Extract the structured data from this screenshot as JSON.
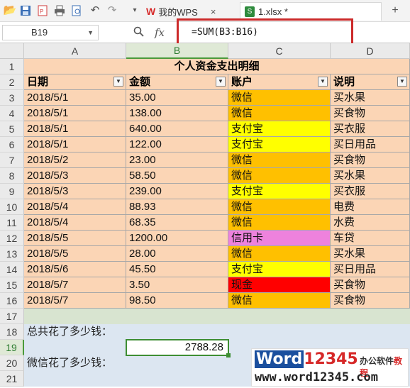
{
  "toolbar": {
    "icons": [
      "open-folder-icon",
      "save-icon",
      "export-pdf-icon",
      "print-icon",
      "print-preview-icon",
      "undo-icon",
      "redo-icon",
      "more-icon"
    ],
    "tabs": [
      {
        "label": "我的WPS",
        "close": "×"
      },
      {
        "label": "1.xlsx *",
        "close": "×"
      }
    ],
    "add_tab": "+"
  },
  "formula_bar": {
    "name_box": "B19",
    "fx": "fx",
    "formula": "=SUM(B3:B16)"
  },
  "columns": [
    "A",
    "B",
    "C",
    "D"
  ],
  "rows": [
    "1",
    "2",
    "3",
    "4",
    "5",
    "6",
    "7",
    "8",
    "9",
    "10",
    "11",
    "12",
    "13",
    "14",
    "15",
    "16",
    "17",
    "18",
    "19",
    "20",
    "21"
  ],
  "sheet": {
    "title": "个人资金支出明细",
    "headers": [
      "日期",
      "金额",
      "账户",
      "说明"
    ],
    "data": [
      {
        "date": "2018/5/1",
        "amount": "35.00",
        "account": "微信",
        "note": "买水果",
        "account_color": "#ffc000"
      },
      {
        "date": "2018/5/1",
        "amount": "138.00",
        "account": "微信",
        "note": "买食物",
        "account_color": "#ffc000"
      },
      {
        "date": "2018/5/1",
        "amount": "640.00",
        "account": "支付宝",
        "note": "买衣服",
        "account_color": "#ffff00"
      },
      {
        "date": "2018/5/1",
        "amount": "122.00",
        "account": "支付宝",
        "note": "买日用品",
        "account_color": "#ffff00"
      },
      {
        "date": "2018/5/2",
        "amount": "23.00",
        "account": "微信",
        "note": "买食物",
        "account_color": "#ffc000"
      },
      {
        "date": "2018/5/3",
        "amount": "58.50",
        "account": "微信",
        "note": "买水果",
        "account_color": "#ffc000"
      },
      {
        "date": "2018/5/3",
        "amount": "239.00",
        "account": "支付宝",
        "note": "买衣服",
        "account_color": "#ffff00"
      },
      {
        "date": "2018/5/4",
        "amount": "88.93",
        "account": "微信",
        "note": "电费",
        "account_color": "#ffc000"
      },
      {
        "date": "2018/5/4",
        "amount": "68.35",
        "account": "微信",
        "note": "水费",
        "account_color": "#ffc000"
      },
      {
        "date": "2018/5/5",
        "amount": "1200.00",
        "account": "信用卡",
        "note": "车贷",
        "account_color": "#ee82dd"
      },
      {
        "date": "2018/5/5",
        "amount": "28.00",
        "account": "微信",
        "note": "买水果",
        "account_color": "#ffc000"
      },
      {
        "date": "2018/5/6",
        "amount": "45.50",
        "account": "支付宝",
        "note": "买日用品",
        "account_color": "#ffff00"
      },
      {
        "date": "2018/5/7",
        "amount": "3.50",
        "account": "现金",
        "note": "买食物",
        "account_color": "#ff0000"
      },
      {
        "date": "2018/5/7",
        "amount": "98.50",
        "account": "微信",
        "note": "买食物",
        "account_color": "#ffc000"
      }
    ],
    "q1_label": "总共花了多少钱：",
    "q1_result": "2788.28",
    "q2_label": "微信花了多少钱："
  },
  "colors": {
    "table_fill": "#fbd5b5",
    "summary_fill": "#dce6f1",
    "selection": "#3e8e33",
    "highlight_box": "#cc2a2a"
  },
  "watermark": {
    "brand_word": "Word",
    "brand_num": "12345",
    "tag1": "办公软件",
    "tag2": "教程",
    "url": "www.word12345.com"
  }
}
